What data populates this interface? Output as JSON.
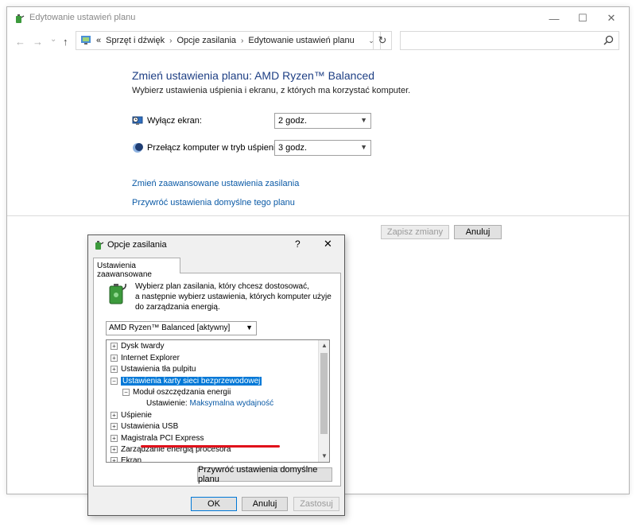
{
  "window": {
    "title": "Edytowanie ustawień planu",
    "minimize_glyph": "—",
    "maximize_glyph": "☐",
    "close_glyph": "✕"
  },
  "nav": {
    "back_glyph": "←",
    "forward_glyph": "→",
    "recent_glyph": "⌄",
    "up_glyph": "↑",
    "overflow": "«",
    "breadcrumbs": [
      "Sprzęt i dźwięk",
      "Opcje zasilania",
      "Edytowanie ustawień planu"
    ],
    "separator": "›",
    "dropdown_glyph": "⌄",
    "refresh_glyph": "↻",
    "search_placeholder": ""
  },
  "main": {
    "title": "Zmień ustawienia planu: AMD Ryzen™ Balanced",
    "subtitle": "Wybierz ustawienia uśpienia i ekranu, z których ma korzystać komputer.",
    "display_label": "Wyłącz ekran:",
    "display_value": "2 godz.",
    "sleep_label": "Przełącz komputer w tryb uśpienia:",
    "sleep_value": "3 godz.",
    "advanced_link": "Zmień zaawansowane ustawienia zasilania",
    "restore_link": "Przywróć ustawienia domyślne tego planu",
    "save_button": "Zapisz zmiany",
    "cancel_button": "Anuluj"
  },
  "dialog": {
    "title": "Opcje zasilania",
    "help_glyph": "?",
    "close_glyph": "✕",
    "tab_label": "Ustawienia zaawansowane",
    "description_lines": [
      "Wybierz plan zasilania, który chcesz dostosować,",
      "a następnie wybierz ustawienia, których komputer użyje",
      "do zarządzania energią."
    ],
    "plan_select": "AMD Ryzen™ Balanced [aktywny]",
    "tree": {
      "items": [
        {
          "toggle": "+",
          "label": "Dysk twardy"
        },
        {
          "toggle": "+",
          "label": "Internet Explorer"
        },
        {
          "toggle": "+",
          "label": "Ustawienia tła pulpitu"
        },
        {
          "toggle": "−",
          "label": "Ustawienia karty sieci bezprzewodowej"
        },
        {
          "toggle": "−",
          "label": "Moduł oszczędzania energii"
        },
        {
          "toggle": "+",
          "label": "Uśpienie"
        },
        {
          "toggle": "+",
          "label": "Ustawienia USB"
        },
        {
          "toggle": "+",
          "label": "Magistrala PCI Express"
        },
        {
          "toggle": "+",
          "label": "Zarządzanie energią procesora"
        },
        {
          "toggle": "+",
          "label": "Ekran"
        }
      ],
      "setting_label": "Ustawienie:",
      "setting_value": "Maksymalna wydajność"
    },
    "scroll_up_glyph": "▲",
    "scroll_down_glyph": "▼",
    "restore_defaults_button": "Przywróć ustawienia domyślne planu",
    "ok_button": "OK",
    "cancel_button": "Anuluj",
    "apply_button": "Zastosuj"
  },
  "icons": {
    "app": "power-options-icon",
    "display": "monitor-clock-icon",
    "sleep": "moon-icon",
    "search": "search-icon",
    "battery": "battery-plug-icon"
  },
  "colors": {
    "title_blue": "#1e3f84",
    "link_blue": "#0b5aa6",
    "selection_blue": "#0078d7",
    "annotation_red": "#e0101a"
  }
}
